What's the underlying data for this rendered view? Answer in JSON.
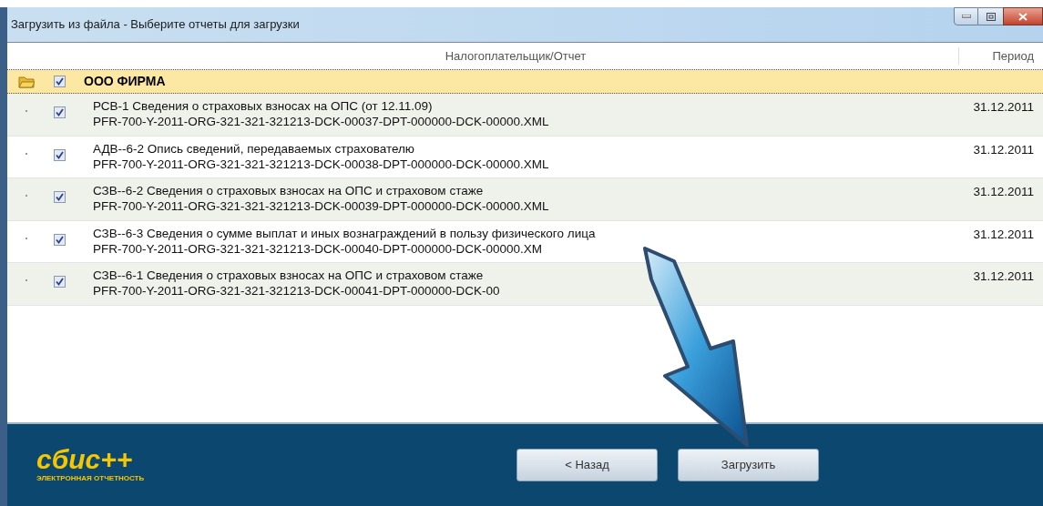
{
  "window": {
    "title": "Загрузить из файла - Выберите отчеты для загрузки"
  },
  "table": {
    "columns": [
      "Налогоплательщик/Отчет",
      "Период"
    ],
    "group": {
      "name": "ООО ФИРМА",
      "checked": true,
      "expanded": true
    },
    "rows": [
      {
        "title": "РСВ-1 Сведения о страховых взносах на ОПС (от 12.11.09)",
        "file": "PFR-700-Y-2011-ORG-321-321-321213-DCK-00037-DPT-000000-DCK-00000.XML",
        "period": "31.12.2011",
        "checked": true
      },
      {
        "title": "АДВ--6-2 Опись сведений, передаваемых страхователю",
        "file": "PFR-700-Y-2011-ORG-321-321-321213-DCK-00038-DPT-000000-DCK-00000.XML",
        "period": "31.12.2011",
        "checked": true
      },
      {
        "title": "СЗВ--6-2 Сведения о страховых взносах на ОПС и страховом стаже",
        "file": "PFR-700-Y-2011-ORG-321-321-321213-DCK-00039-DPT-000000-DCK-00000.XML",
        "period": "31.12.2011",
        "checked": true
      },
      {
        "title": "СЗВ--6-3 Сведения о сумме выплат и иных вознаграждений в пользу физического лица",
        "file": "PFR-700-Y-2011-ORG-321-321-321213-DCK-00040-DPT-000000-DCK-00000.XM",
        "period": "31.12.2011",
        "checked": true
      },
      {
        "title": "СЗВ--6-1 Сведения о страховых взносах на ОПС и страховом стаже",
        "file": "PFR-700-Y-2011-ORG-321-321-321213-DCK-00041-DPT-000000-DCK-00",
        "period": "31.12.2011",
        "checked": true
      }
    ]
  },
  "footer": {
    "logo": "сбис++",
    "logo_subtitle": "ЭЛЕКТРОННАЯ ОТЧЕТНОСТЬ",
    "buttons": [
      {
        "label": "< Назад",
        "disabled": false
      },
      {
        "label": "Загрузить",
        "disabled": false
      }
    ]
  }
}
